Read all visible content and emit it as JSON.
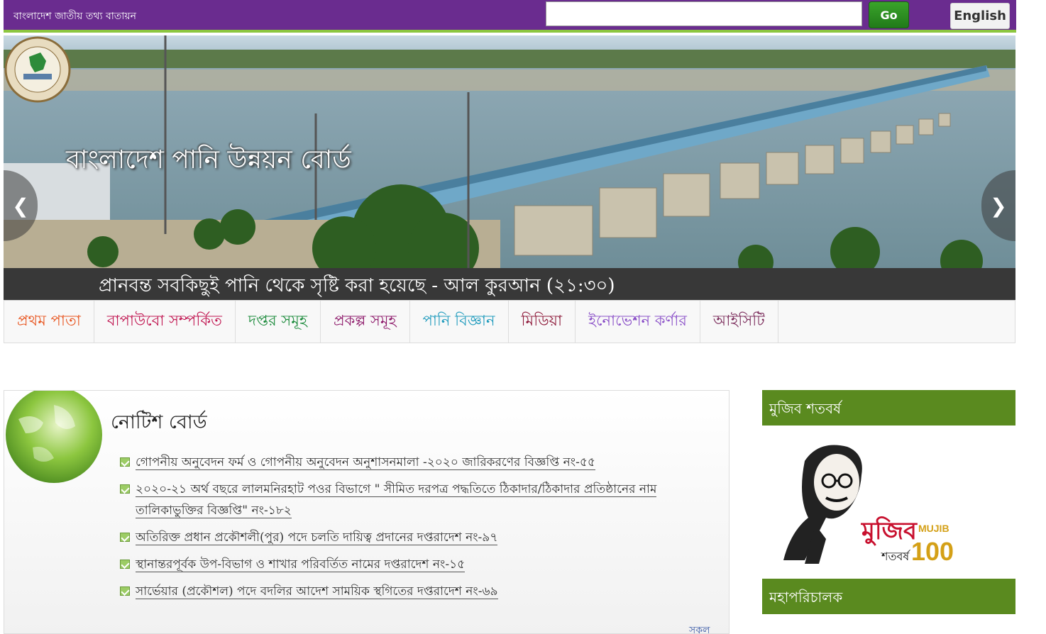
{
  "topbar": {
    "portal_title": "বাংলাদেশ জাতীয় তথ্য বাতায়ন",
    "search_placeholder": "",
    "go_label": "Go",
    "english_label": "English"
  },
  "banner": {
    "site_title": "বাংলাদেশ পানি উন্নয়ন বোর্ড",
    "prev_icon": "chevron-left-icon",
    "next_icon": "chevron-right-icon",
    "prev_glyph": "❮",
    "next_glyph": "❯"
  },
  "quote": "প্রানবন্ত সবকিছুই পানি থেকে সৃষ্টি করা হয়েছে - আল কুরআন (২১:৩০)",
  "nav": [
    {
      "label": "প্রথম পাতা",
      "color": "#e8541e"
    },
    {
      "label": "বাপাউবো সম্পর্কিত",
      "color": "#c0134f"
    },
    {
      "label": "দপ্তর সমূহ",
      "color": "#1a8a3a"
    },
    {
      "label": "প্রকল্প সমূহ",
      "color": "#8e1a6b"
    },
    {
      "label": "পানি বিজ্ঞান",
      "color": "#1f9bbd"
    },
    {
      "label": "মিডিয়া",
      "color": "#8e1a3a"
    },
    {
      "label": "ইনোভেশন কর্ণার",
      "color": "#8a4fc8"
    },
    {
      "label": "আইসিটি",
      "color": "#7a2a5a"
    }
  ],
  "notice_board": {
    "title": "নোটিশ বোর্ড",
    "items": [
      "গোপনীয় অনুবেদন ফর্ম ও গোপনীয় অনুবেদন অনুশাসনমালা -২০২০ জারিকরণের বিজ্ঞপ্তি নং-৫৫",
      "২০২০-২১ অর্থ বছরে লালমনিরহাট পওর বিভাগে \" সীমিত দরপত্র পদ্ধতিতে ঠিকাদার/ঠিকাদার প্রতিষ্ঠানের নাম তালিকাভুক্তির বিজ্ঞপ্তি\" নং-১৮২",
      "অতিরিক্ত প্রধান প্রকৌশলী(পুর) পদে চলতি দায়িত্ব প্রদানের দপ্তরাদেশ নং-৯৭",
      "স্থানান্তরপূর্বক উপ-বিভাগ ও শাখার পরিবর্তিত নামের দপ্তরাদেশ নং-১৫",
      "সার্ভেয়ার (প্রকৌশল) পদে বদলির আদেশ সাময়িক স্থগিতের দপ্তরাদেশ নং-৬৯"
    ],
    "all_link": "সকল"
  },
  "sidebar": {
    "mujib_header": "মুজিব শতবর্ষ",
    "mujib_logo_text": "মুজিব",
    "mujib_logo_sub": "শতবর্ষ",
    "mujib_logo_en": "MUJIB",
    "mujib_logo_num": "100",
    "dg_header": "মহাপরিচালক"
  },
  "colors": {
    "topbar": "#6a2c8f",
    "topbar_accent": "#8cc63f",
    "sidebar_header": "#5a8a1f",
    "quote_bar": "#383838"
  }
}
